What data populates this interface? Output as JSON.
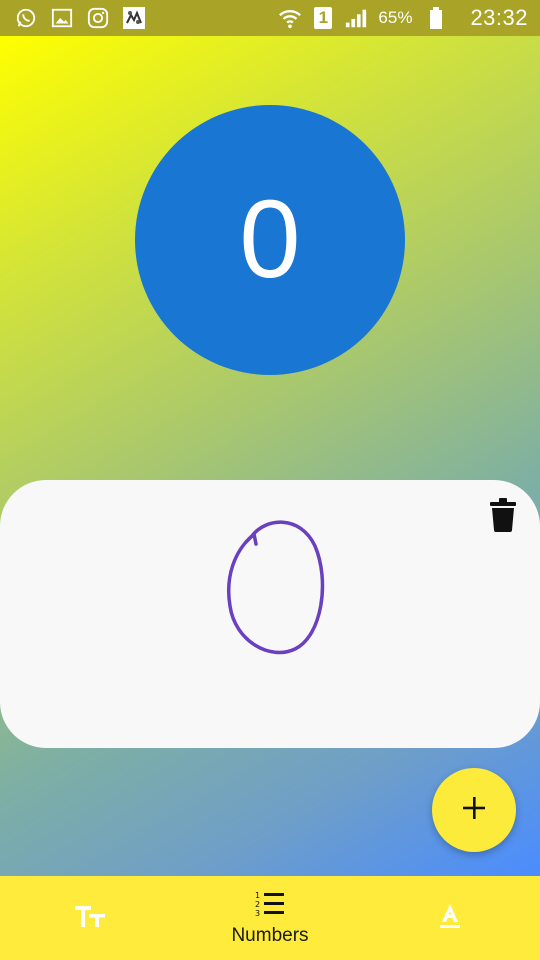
{
  "status_bar": {
    "left_icons": [
      "whatsapp-icon",
      "gallery-icon",
      "instagram-icon",
      "app-icon"
    ],
    "sim_slot": "1",
    "battery_percent": "65%",
    "time": "23:32"
  },
  "counter": {
    "value": "0",
    "color": "#1976d2"
  },
  "card": {
    "delete_icon": "trash-icon"
  },
  "fab": {
    "icon": "plus-icon",
    "color": "#fdeb3b"
  },
  "bottom_nav": {
    "items": [
      {
        "icon": "text-size-icon",
        "label": ""
      },
      {
        "icon": "numbered-list-icon",
        "label": "Numbers",
        "active": true
      },
      {
        "icon": "text-format-icon",
        "label": ""
      }
    ],
    "color": "#ffeb3b"
  }
}
